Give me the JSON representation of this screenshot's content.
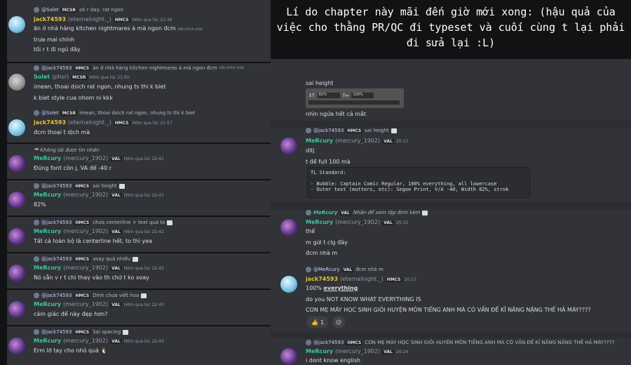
{
  "title": "Lí do chapter này mãi đến giờ mới xong: (hậu quả của việc cho thằng PR/QC đi typeset và cuối cùng t lại phải đi sửa lại :L)",
  "left": {
    "m1": {
      "reply_name": "@Solet",
      "reply_tag": "MCSR",
      "reply_text": "ok r day, rat ngon",
      "name": "jack74593",
      "handle": "(eternalnight._)",
      "tag": "HMCS",
      "time": "Hôm qua lúc 21:36",
      "lines": [
        "ăn ở nhà hàng kitchen nightmares à mà ngon đcm",
        "trưa mai chính",
        "tối r t đi ngủ đây"
      ],
      "edited": "(đã chỉnh sửa)"
    },
    "m2": {
      "reply_name": "@jack74593",
      "reply_tag": "HMCS",
      "reply_text": "ăn ở nhà hàng kitchen nightmares à mà ngon đcm",
      "reply_edited": "(đã chỉnh sửa)",
      "name": "Solet",
      "handle": "(phsr)",
      "tag": "MCSR",
      "time": "Hôm qua lúc 21:50",
      "lines": [
        "imean, thoai dsich rat ngon, nhung ts thi k biet",
        "k biet style cua nhom ni kkk"
      ]
    },
    "m3": {
      "reply_name": "@Solet",
      "reply_tag": "MCSR",
      "reply_text": "imean, thoai dsich rat ngon, nhung ts thi k biet",
      "name": "jack74593",
      "handle": "(eternalnight._)",
      "tag": "HMCS",
      "time": "Hôm qua lúc 21:57",
      "lines": [
        "đcm thoại t dịch mà"
      ]
    },
    "m4": {
      "reply_text": "Không tải được tin nhắn",
      "name": "MeRcury",
      "handle": "(mercury_1902)",
      "tag": "VAL",
      "time": "Hôm qua lúc 22:41",
      "lines": [
        "Đúng font còn j, VA để -40 r"
      ]
    },
    "m5": {
      "reply_name": "@jack74593",
      "reply_tag": "HMCS",
      "reply_text": "sai height",
      "name": "MeRcury",
      "handle": "(mercury_1902)",
      "tag": "VAL",
      "time": "Hôm qua lúc 22:41",
      "lines": [
        "82%"
      ]
    },
    "m6": {
      "reply_name": "@jack74593",
      "reply_tag": "HMCS",
      "reply_text": "chưa centerline + text quá to",
      "name": "MeRcury",
      "handle": "(mercury_1902)",
      "tag": "VAL",
      "time": "Hôm qua lúc 22:42",
      "lines": [
        "Tất cả toàn bộ là centerline hết, to thì yea"
      ]
    },
    "m7": {
      "reply_name": "@jack74593",
      "reply_tag": "HMCS",
      "reply_text": "xoay quá nhiều",
      "name": "MeRcury",
      "handle": "(mercury_1902)",
      "tag": "VAL",
      "time": "Hôm qua lúc 22:42",
      "lines": [
        "Nó sẵn v r t chỉ thay vào th chứ t ko xoay"
      ]
    },
    "m8": {
      "reply_name": "@jack74593",
      "reply_tag": "HMCS",
      "reply_text": "Dính chưa viết hoa",
      "name": "MeRcury",
      "handle": "(mercury_1902)",
      "tag": "VAL",
      "time": "Hôm qua lúc 22:43",
      "lines": [
        "cảm giác để này đẹp hơn?"
      ]
    },
    "m9": {
      "reply_name": "@jack74593",
      "reply_tag": "HMCS",
      "reply_text": "Sai spacing",
      "name": "MeRcury",
      "handle": "(mercury_1902)",
      "tag": "VAL",
      "time": "Hôm qua lúc 22:43",
      "lines": [
        "Erm lỡ tay cho nhỏ quá 🐧"
      ]
    }
  },
  "right": {
    "r0": {
      "lines": [
        "sai height"
      ]
    },
    "ps": {
      "height_label": "82%",
      "track_label": "100%"
    },
    "r0b": {
      "lines": [
        "nhìn ngứa hết cả mắt"
      ]
    },
    "r1": {
      "reply_name": "@jack74593",
      "reply_tag": "HMCS",
      "reply_text": "sai height",
      "name": "MeRcury",
      "handle": "(mercury_1902)",
      "tag": "VAL",
      "time": "20:11",
      "lines": [
        "ditj",
        "t để full 100 mà"
      ]
    },
    "code": "TL Standard:\n\n- Bubble: Captain Comic Regular, 100% everything, all lowercase\n- Outer text (mutters, etc): Segoe Print, V/A -40, Width 82%, strok",
    "r2": {
      "reply_name": "MeRcury",
      "reply_tag": "VAL",
      "reply_text": "Nhấn để xem tệp đính kèm",
      "name": "MeRcury",
      "handle": "(mercury_1902)",
      "tag": "VAL",
      "time": "20:12",
      "lines": [
        "thế",
        "m gửi t clg đây",
        "đcm nhà m"
      ]
    },
    "r3": {
      "reply_name": "@MeRcury",
      "reply_tag": "VAL",
      "reply_text": "đcm nhà m",
      "name": "jack74593",
      "handle": "(eternalnight._)",
      "tag": "HMCS",
      "time": "20:17",
      "line1_pre": "100% ",
      "line1_bold": "everything",
      "lines": [
        "do you NOT KNOW WHAT EVERYTHING IS",
        "CON MẸ MÀY HỌC SINH GIỎI HUYỆN MÔN TIẾNG ANH MÀ CÓ VẤN ĐỀ KĨ NĂNG NẶNG THẾ HẢ MÀY????"
      ],
      "reactions": [
        {
          "emoji": "👍",
          "count": "1"
        },
        {
          "emoji": "☹",
          "count": ""
        }
      ]
    },
    "r4": {
      "reply_name": "@jack74593",
      "reply_tag": "HMCS",
      "reply_text": "CON MẸ MÀY HỌC SINH GIỎI HUYỆN MÔN TIẾNG ANH MÀ CÓ VẤN ĐỀ KĨ NĂNG NẶNG THẾ HẢ MÀY????",
      "name": "MeRcury",
      "handle": "(mercury_1902)",
      "tag": "VAL",
      "time": "20:24",
      "lines": [
        "i dont know english"
      ]
    }
  }
}
